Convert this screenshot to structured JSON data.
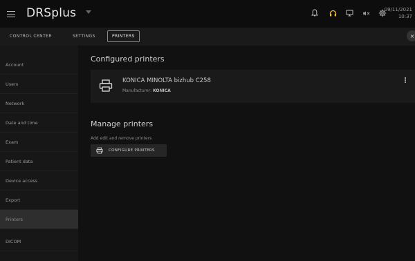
{
  "app": {
    "title": "DRSplus"
  },
  "topbar": {
    "date": "09/11/2021",
    "time": "10:37"
  },
  "tabs": [
    {
      "label": "CONTROL CENTER"
    },
    {
      "label": "SETTINGS"
    },
    {
      "label": "PRINTERS"
    }
  ],
  "tab_close": "×",
  "sidebar": {
    "items": [
      {
        "label": "Account"
      },
      {
        "label": "Users"
      },
      {
        "label": "Network"
      },
      {
        "label": "Date and time"
      },
      {
        "label": "Exam"
      },
      {
        "label": "Patient data"
      },
      {
        "label": "Device access"
      },
      {
        "label": "Export"
      },
      {
        "label": "Printers"
      },
      {
        "label": "DICOM"
      }
    ],
    "selected": "Printers"
  },
  "main": {
    "configured_title": "Configured printers",
    "printer": {
      "name": "KONICA MINOLTA bizhub C258",
      "manufacturer_label": "Manufacturer:",
      "manufacturer": "KONICA"
    },
    "manage_title": "Manage printers",
    "manage_subtitle": "Add edit and remove printers",
    "configure_button": "CONFIGURE PRINTERS"
  },
  "colors": {
    "accent_headset": "#f0c020",
    "background": "#0d0d0d",
    "panel": "#1a1a1a",
    "selected": "#2e2e2e"
  },
  "icons": [
    "menu-icon",
    "dropdown-caret-icon",
    "bell-icon",
    "headset-icon",
    "monitor-icon",
    "mute-icon",
    "gear-icon",
    "close-icon",
    "printer-icon",
    "kebab-icon"
  ]
}
